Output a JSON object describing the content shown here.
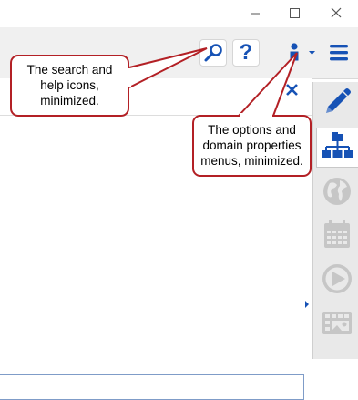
{
  "window": {
    "minimize_icon": "minimize-icon",
    "maximize_icon": "maximize-icon",
    "close_icon": "close-icon"
  },
  "toolbar": {
    "search_icon": "search-icon",
    "help_label": "?",
    "user_icon": "user-icon",
    "menu_icon": "hamburger-menu-icon",
    "accent_color": "#1652b5"
  },
  "sidebar": {
    "items": [
      {
        "icon": "pencil-icon",
        "active": false
      },
      {
        "icon": "domain-hierarchy-icon",
        "active": true
      },
      {
        "icon": "globe-icon",
        "active": false
      },
      {
        "icon": "calendar-icon",
        "active": false
      },
      {
        "icon": "play-icon",
        "active": false
      },
      {
        "icon": "image-gallery-icon",
        "active": false
      }
    ]
  },
  "callouts": {
    "left": {
      "lines": [
        "The search and",
        "help icons,",
        "minimized."
      ]
    },
    "right": {
      "lines": [
        "The options and",
        "domain properties",
        "menus, minimized."
      ]
    },
    "color": "#b32025"
  }
}
